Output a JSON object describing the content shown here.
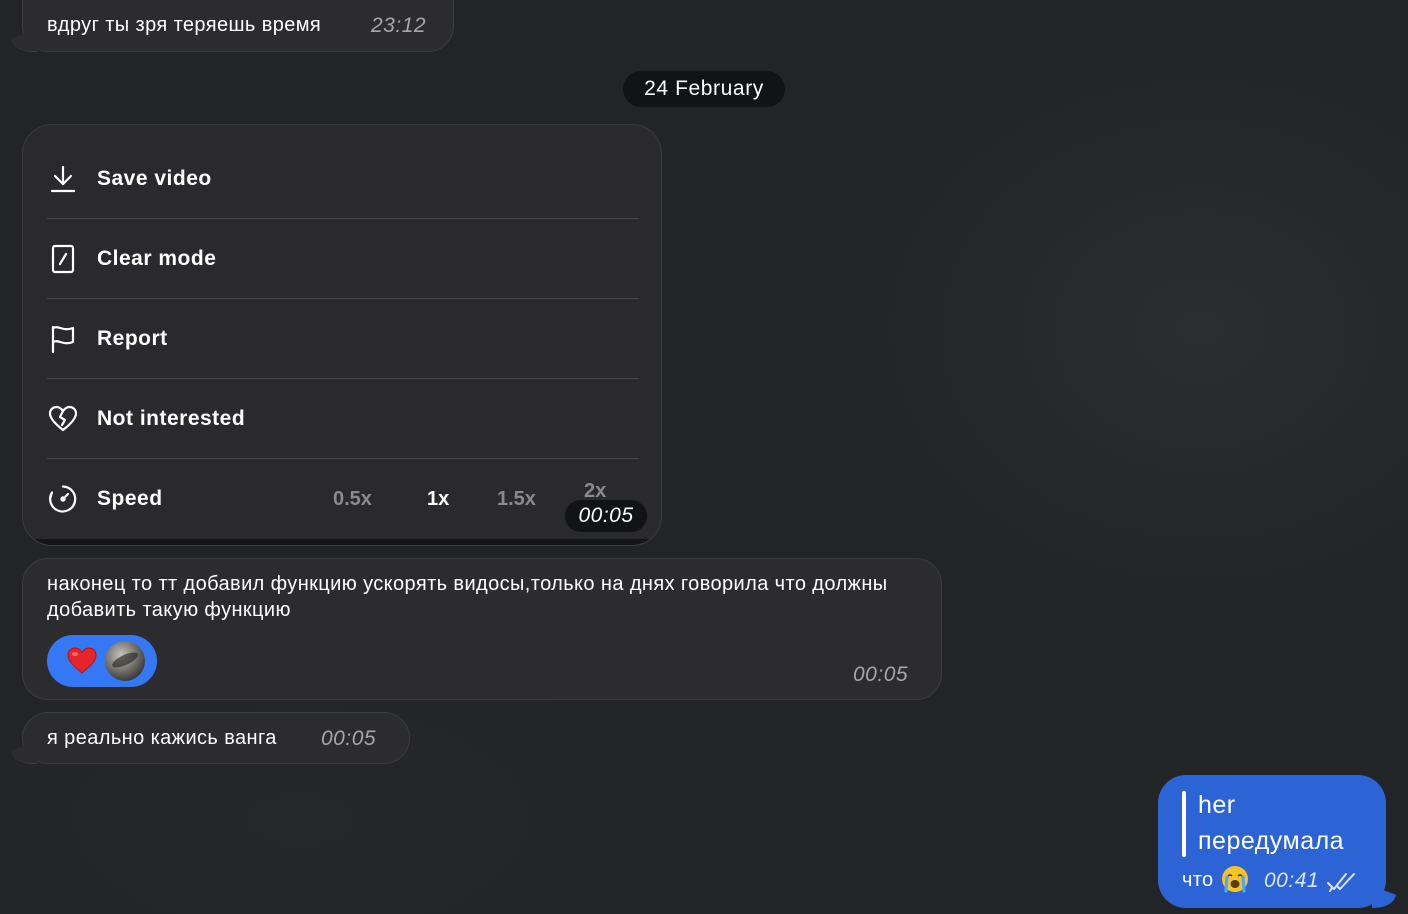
{
  "messages": {
    "m1": {
      "text": "вдруг ты зря теряешь время",
      "time": "23:12"
    },
    "date_separator": "24 February",
    "menu": {
      "items": [
        {
          "label": "Save video",
          "icon": "download-icon"
        },
        {
          "label": "Clear mode",
          "icon": "clear-mode-icon"
        },
        {
          "label": "Report",
          "icon": "flag-icon"
        },
        {
          "label": "Not interested",
          "icon": "broken-heart-icon"
        },
        {
          "label": "Speed",
          "icon": "speed-icon"
        }
      ],
      "speed_options": [
        "0.5x",
        "1x",
        "1.5x",
        "2x"
      ],
      "speed_selected": "1x",
      "time": "00:05"
    },
    "m2": {
      "text": "наконец то тт добавил функцию ускорять видосы,только на днях говорила что должны добавить такую функцию",
      "time": "00:05",
      "reaction": {
        "emoji": "heart-icon",
        "count_avatars": 1
      }
    },
    "m3": {
      "text": "я реально кажись ванга",
      "time": "00:05"
    },
    "m4": {
      "quote_line1": "her",
      "quote_line2": "передумала",
      "text": "что",
      "emoji": "loudly-crying-face-emoji",
      "time": "00:41",
      "status": "read"
    }
  },
  "colors": {
    "background": "#222426",
    "incoming_bubble": "#2c2c2e",
    "outgoing_bubble": "#2c64d6",
    "reaction_pill": "#3478f6",
    "date_pill": "#121314"
  }
}
